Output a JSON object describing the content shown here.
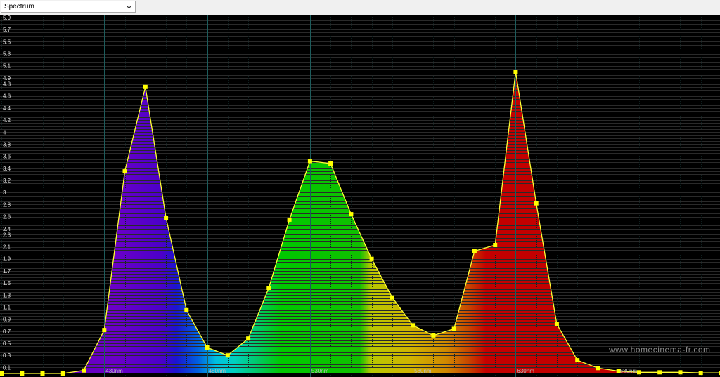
{
  "toolbar": {
    "selected_view": "Spectrum"
  },
  "watermark": "www.homecinema-fr.com",
  "colors": {
    "background": "#000000",
    "grid_major": "#1d5c5c",
    "grid_minor": "#2a2a2a",
    "line": "#ffff33",
    "marker": "#ffff00"
  },
  "chart_data": {
    "type": "area",
    "xlim": [
      380,
      730
    ],
    "ylim": [
      0,
      5.9
    ],
    "yticks": [
      0.1,
      0.3,
      0.5,
      0.7,
      0.9,
      1.1,
      1.3,
      1.5,
      1.7,
      1.9,
      2.1,
      2.3,
      2.4,
      2.6,
      2.8,
      3,
      3.2,
      3.4,
      3.6,
      3.8,
      4,
      4.2,
      4.4,
      4.6,
      4.8,
      4.9,
      5.1,
      5.3,
      5.5,
      5.7,
      5.9
    ],
    "xticks": [
      430,
      480,
      530,
      580,
      630,
      680
    ],
    "xtick_labels": [
      "430nm",
      "480nm",
      "530nm",
      "580nm",
      "630nm",
      "680nm"
    ],
    "x": [
      380,
      390,
      400,
      410,
      420,
      430,
      440,
      450,
      460,
      470,
      480,
      490,
      500,
      510,
      520,
      530,
      540,
      550,
      560,
      570,
      580,
      590,
      600,
      610,
      620,
      630,
      640,
      650,
      660,
      670,
      680,
      690,
      700,
      710,
      720,
      730
    ],
    "values": [
      0.0,
      0.0,
      0.0,
      0.0,
      0.05,
      0.72,
      3.35,
      4.75,
      2.58,
      1.05,
      0.43,
      0.3,
      0.58,
      1.42,
      2.55,
      3.52,
      3.48,
      2.64,
      1.9,
      1.26,
      0.8,
      0.63,
      0.74,
      2.03,
      2.13,
      5.0,
      2.82,
      0.82,
      0.22,
      0.09,
      0.04,
      0.02,
      0.02,
      0.02,
      0.01,
      0.01
    ]
  }
}
